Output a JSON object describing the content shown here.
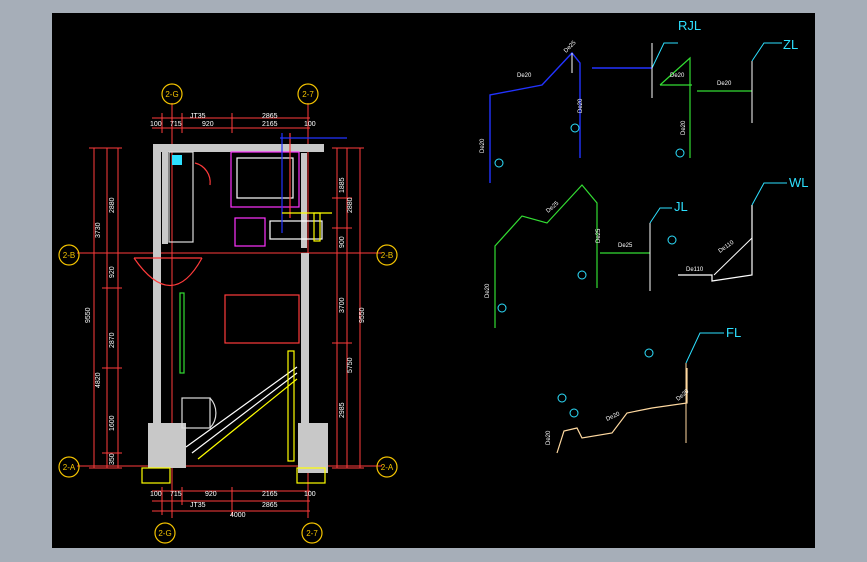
{
  "grid_bubbles": {
    "top_left": "2-G",
    "top_right": "2-7",
    "left_upper": "2-B",
    "right_upper": "2-B",
    "left_lower": "2-A",
    "right_lower": "2-A",
    "bottom_left": "2-G",
    "bottom_right": "2-7"
  },
  "dims_top": {
    "row1_left": "JT35",
    "row1_right": "2865",
    "row2": [
      "100",
      "715",
      "920",
      "2165",
      "100"
    ]
  },
  "dims_bottom": {
    "row1": [
      "100",
      "715",
      "920",
      "2165",
      "100"
    ],
    "row2_left": "JT35",
    "row2_mid": "2865",
    "row3": "4000"
  },
  "dims_left": {
    "outer": "3730",
    "inner1": "2880",
    "inner2": "920",
    "total": "9550",
    "seg_a": "2870",
    "seg_b": "4820",
    "seg_c": "1600",
    "seg_d": "350"
  },
  "dims_right": {
    "a": "1885",
    "b": "2880",
    "c": "900",
    "d": "3700",
    "e": "9550",
    "f": "5750",
    "g": "2985"
  },
  "systems": {
    "rjl": "RJL",
    "zl": "ZL",
    "wl": "WL",
    "jl": "JL",
    "fl": "FL"
  },
  "pipe_labels": {
    "rjl_1": "De25",
    "rjl_2": "De20",
    "rjl_3": "De20",
    "rjl_4": "De20",
    "zl_1": "De20",
    "zl_2": "De20",
    "zl_3": "De20",
    "jl_1": "De25",
    "jl_2": "De25",
    "jl_3": "De25",
    "jl_4": "De20",
    "wl_1": "De110",
    "wl_2": "De110",
    "fl_1": "De20",
    "fl_2": "De20",
    "fl_3": "De20"
  },
  "colors": {
    "background": "#000000",
    "frame": "#a6aeb8",
    "wall": "#c8c8c8",
    "dim": "#ff3b3b",
    "grid_bubble": "#f2c200",
    "rjl": "#2233ff",
    "zl": "#33dd33",
    "jl": "#33dd33",
    "wl": "#ffffff",
    "fl": "#ffd9a0",
    "label_cyan": "#2de0ff"
  }
}
